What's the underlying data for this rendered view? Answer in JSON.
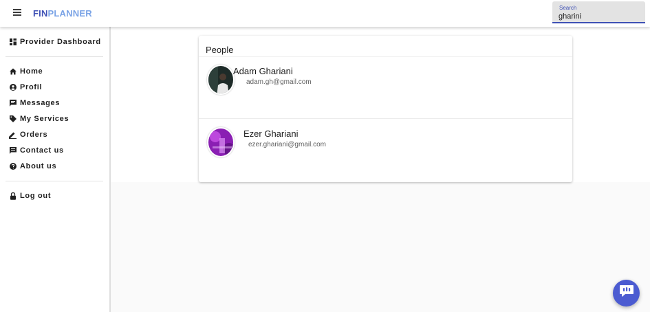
{
  "header": {
    "logo_part1": "FIN",
    "logo_part2": "PLANNER",
    "search": {
      "label": "Search",
      "value": "gharini"
    }
  },
  "sidebar": {
    "dashboard": {
      "label": "Provider Dashboard",
      "icon": "dashboard-icon"
    },
    "items": [
      {
        "label": "Home",
        "icon": "home-icon"
      },
      {
        "label": "Profil",
        "icon": "account-circle-icon"
      },
      {
        "label": "Messages",
        "icon": "message-icon"
      },
      {
        "label": "My Services",
        "icon": "tag-icon"
      },
      {
        "label": "Orders",
        "icon": "pencil-icon"
      },
      {
        "label": "Contact us",
        "icon": "chat-icon"
      },
      {
        "label": "About us",
        "icon": "help-icon"
      }
    ],
    "logout": {
      "label": "Log out",
      "icon": "lock-icon"
    }
  },
  "people": {
    "title": "People",
    "list": [
      {
        "name": "Adam Ghariani",
        "email": "adam.gh@gmail.com"
      },
      {
        "name": "Ezer Ghariani",
        "email": "ezer.ghariani@gmail.com"
      }
    ]
  },
  "colors": {
    "primary": "#3f51b5",
    "logo_secondary": "#7aa3e6",
    "fab": "#4b5bd1"
  }
}
